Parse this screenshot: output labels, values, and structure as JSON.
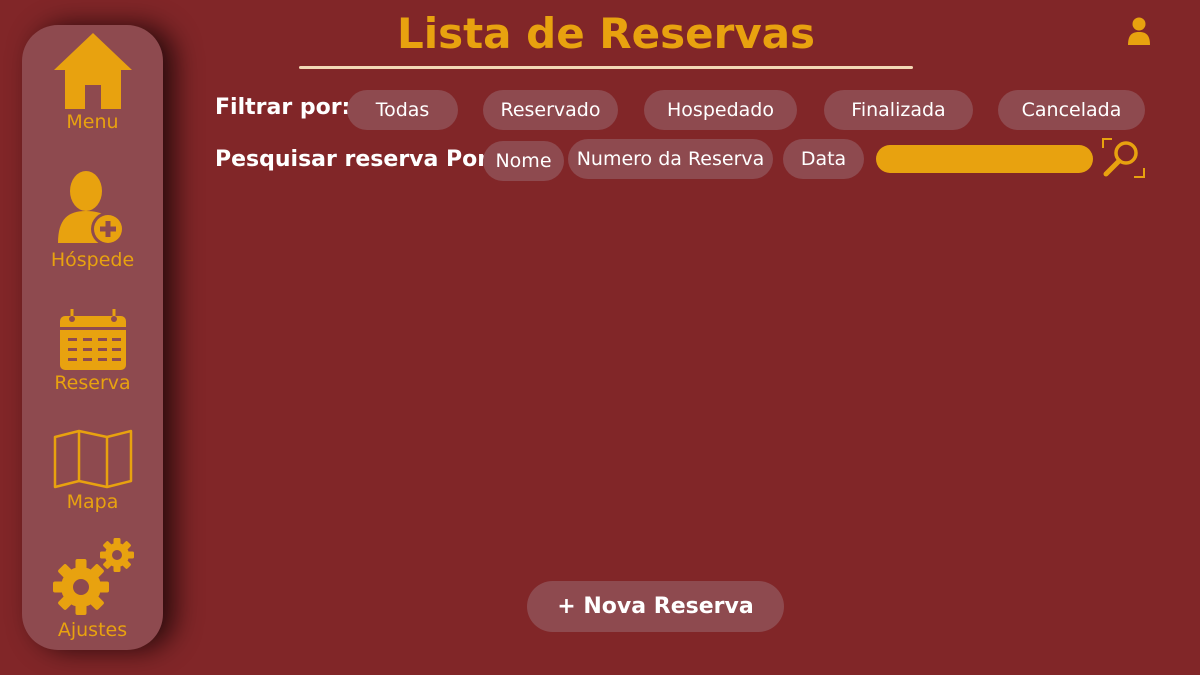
{
  "sidebar": {
    "items": [
      {
        "label": "Menu",
        "icon": "home-icon"
      },
      {
        "label": "Hóspede",
        "icon": "add-guest-icon"
      },
      {
        "label": "Reserva",
        "icon": "calendar-icon"
      },
      {
        "label": "Mapa",
        "icon": "map-icon"
      },
      {
        "label": "Ajustes",
        "icon": "gears-icon"
      }
    ]
  },
  "header": {
    "title": "Lista de Reservas",
    "user_icon": "user-icon"
  },
  "filters": {
    "label": "Filtrar por:",
    "options": [
      "Todas",
      "Reservado",
      "Hospedado",
      "Finalizada",
      "Cancelada"
    ]
  },
  "search": {
    "label": "Pesquisar reserva Por:",
    "options": [
      "Nome",
      "Numero da Reserva",
      "Data"
    ],
    "value": "",
    "icon": "search-icon"
  },
  "actions": {
    "new_reservation": "+ Nova Reserva"
  },
  "colors": {
    "background": "#812628",
    "panel": "#8e4a4f",
    "accent": "#e8a20f",
    "text": "#ffffff"
  }
}
